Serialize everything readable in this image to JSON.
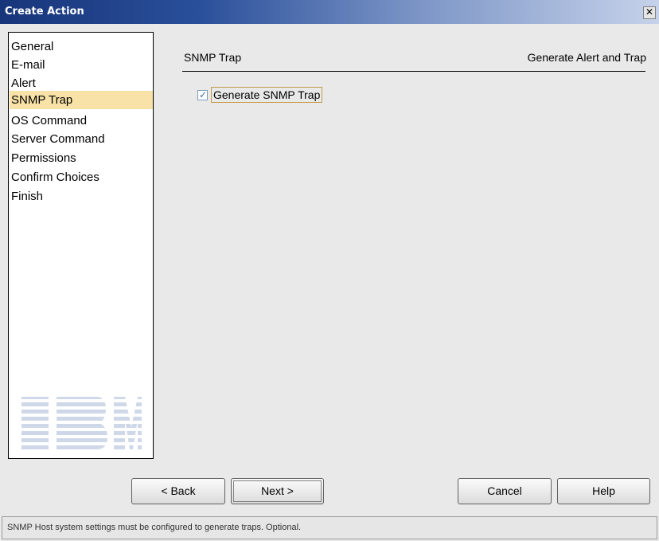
{
  "window": {
    "title": "Create Action",
    "close_glyph": "✕"
  },
  "nav": {
    "items": [
      {
        "label": "General",
        "selected": false
      },
      {
        "label": "E-mail",
        "selected": false
      },
      {
        "label": "Alert",
        "selected": false
      },
      {
        "label": "SNMP Trap",
        "selected": true
      },
      {
        "label": "OS Command",
        "selected": false
      },
      {
        "label": "Server Command",
        "selected": false
      },
      {
        "label": "Permissions",
        "selected": false
      },
      {
        "label": "Confirm Choices",
        "selected": false
      },
      {
        "label": "Finish",
        "selected": false
      }
    ],
    "logo_text": "IBM",
    "selected_color": "#f8e2a7"
  },
  "main": {
    "section_title": "SNMP Trap",
    "section_subtitle": "Generate Alert and Trap",
    "checkbox": {
      "label": "Generate SNMP Trap",
      "checked": true
    }
  },
  "buttons": {
    "back": "< Back",
    "next": "Next >",
    "cancel": "Cancel",
    "help": "Help"
  },
  "status": {
    "text": "SNMP Host system settings must be configured to generate traps. Optional."
  },
  "colors": {
    "titlebar_start": "#17357a",
    "titlebar_end": "#c6d2ea",
    "checkbox_mark": "#3f69b7",
    "focus_border": "#c29a4b"
  }
}
